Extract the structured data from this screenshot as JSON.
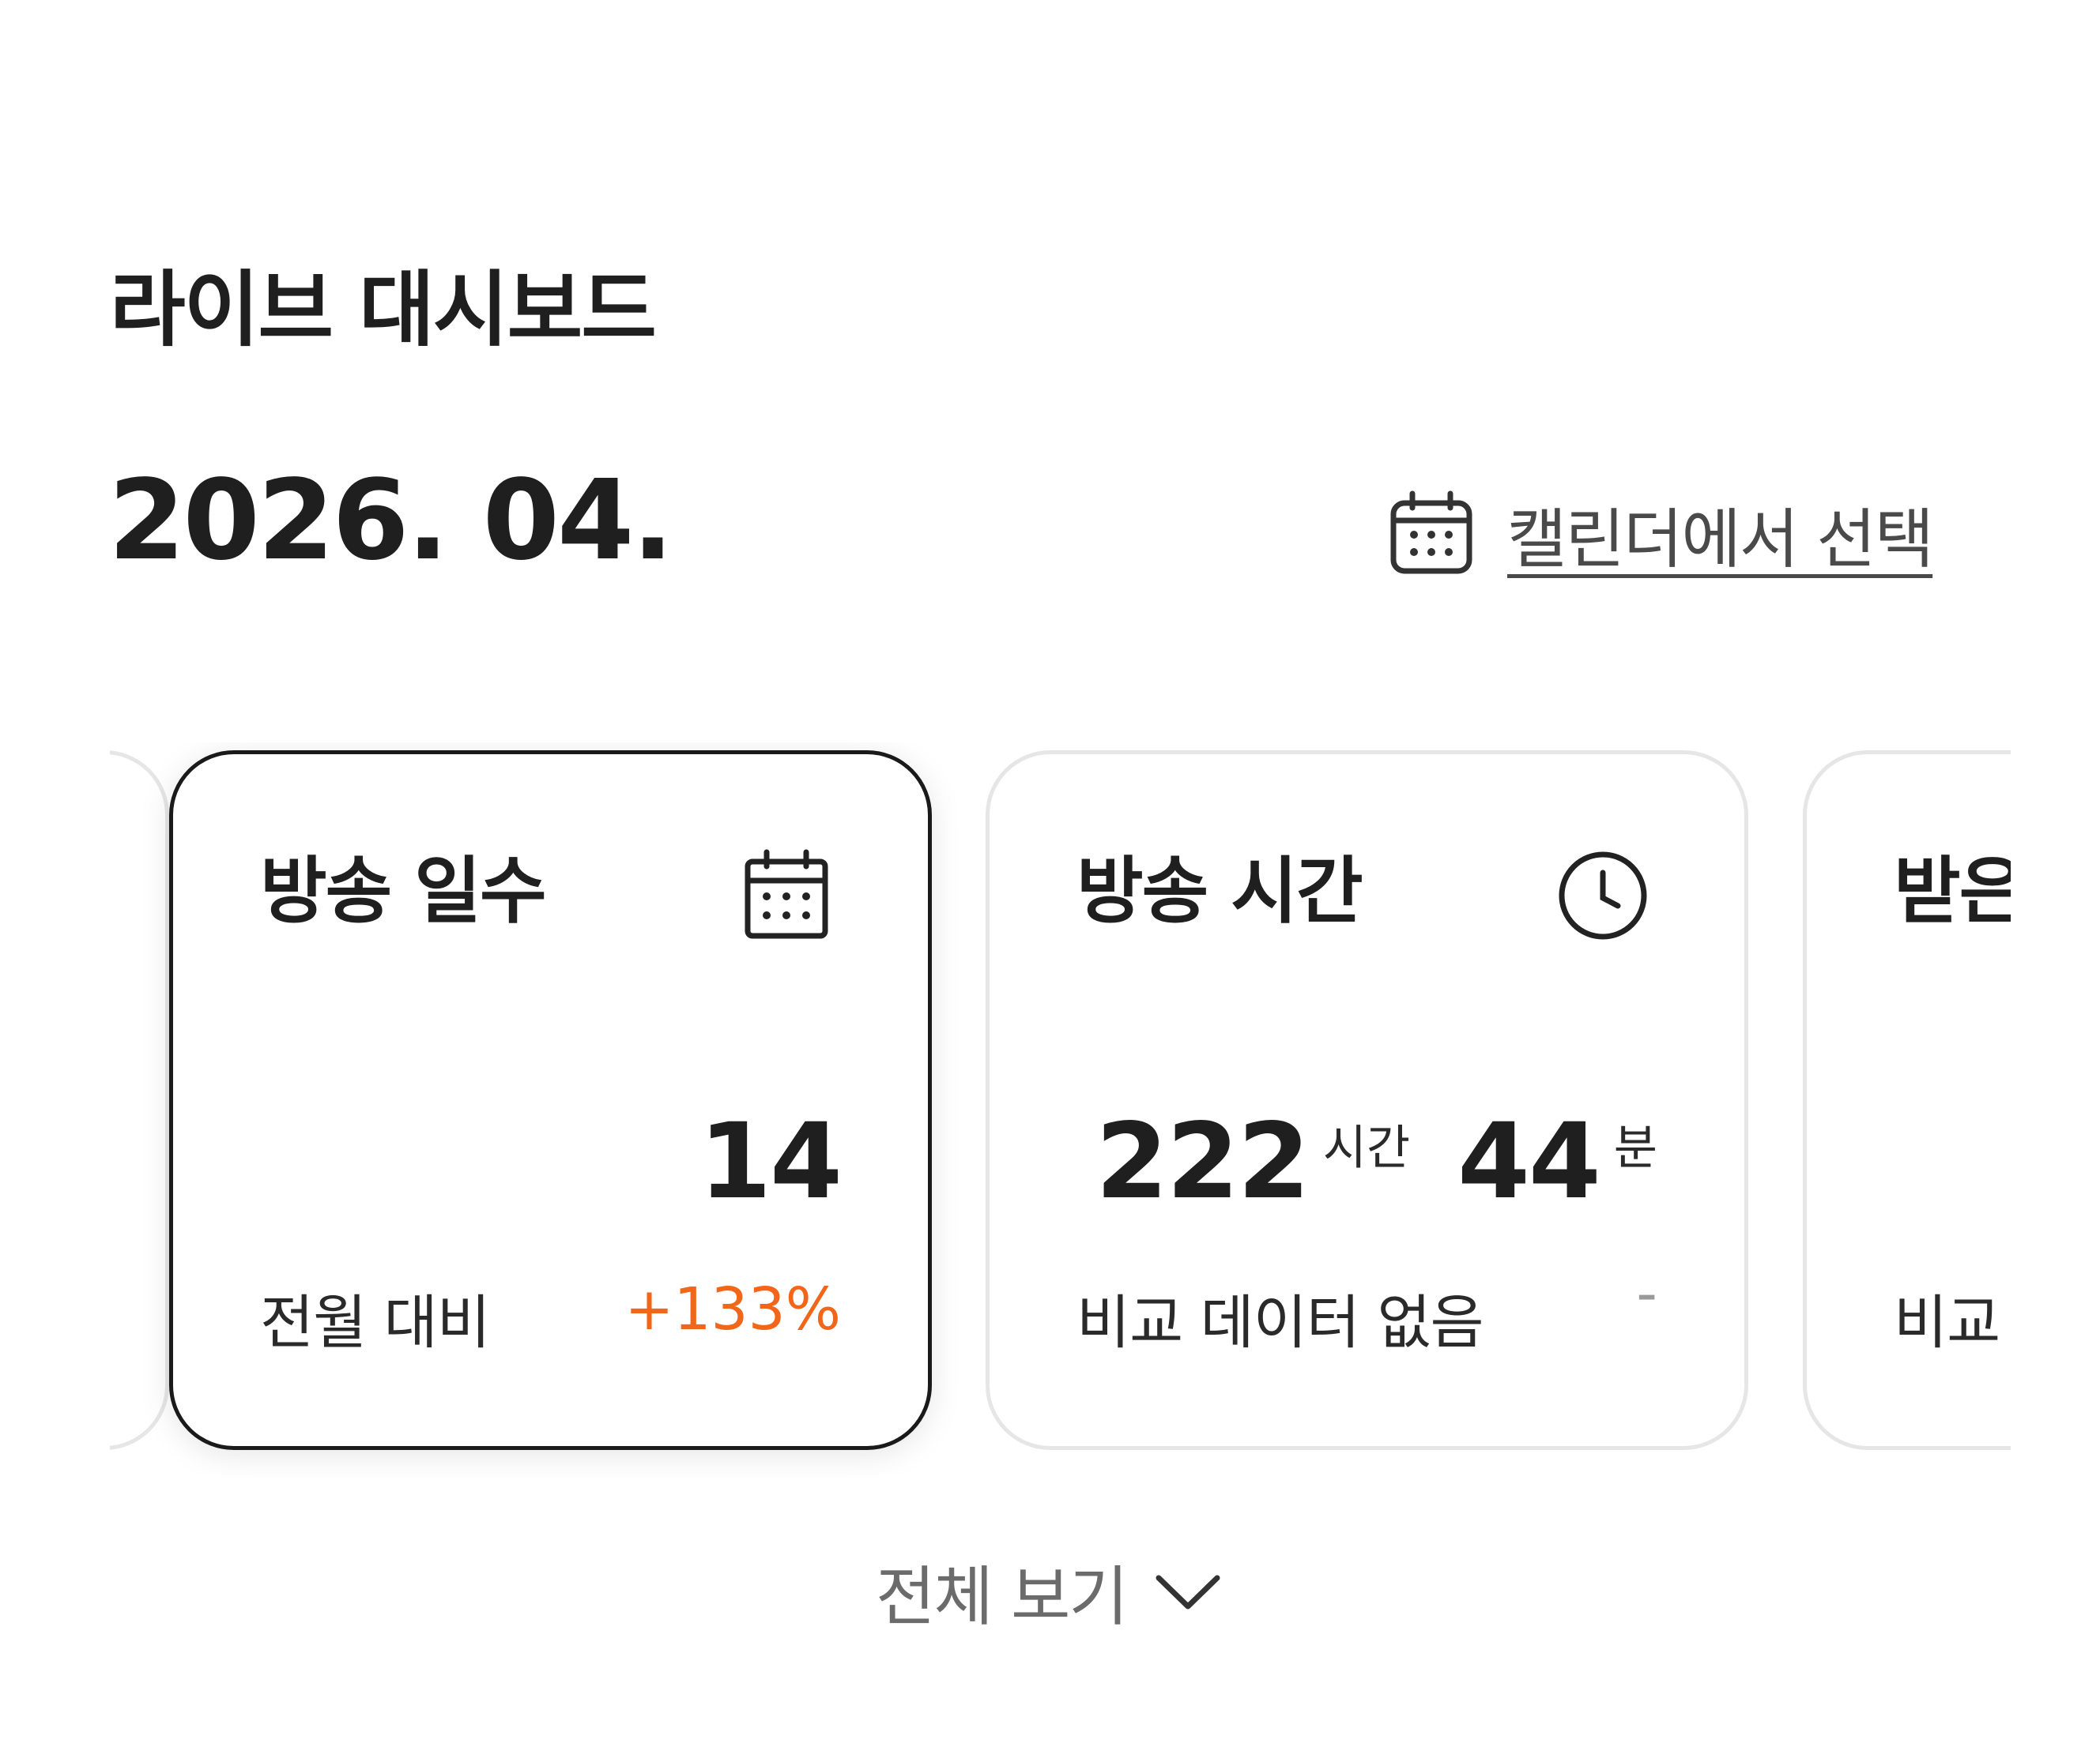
{
  "header": {
    "title": "라이브 대시보드",
    "month": "2026. 04.",
    "calendar_select_label": "캘린더에서 선택"
  },
  "cards": [
    {
      "title": "방송 일수",
      "icon": "calendar-icon",
      "value": "14",
      "compare_label": "전월 대비",
      "compare_value": "+133%",
      "selected": true
    },
    {
      "title": "방송 시간",
      "icon": "clock-icon",
      "hours_value": "222",
      "hours_unit": "시간",
      "minutes_value": "44",
      "minutes_unit": "분",
      "compare_label": "비교 데이터 없음",
      "compare_value": "-",
      "selected": false
    },
    {
      "title": "받은",
      "compare_label": "비교",
      "partial": true
    }
  ],
  "footer": {
    "see_all_label": "전체 보기"
  },
  "colors": {
    "positive": "#f2661a",
    "text": "#1f1f1f",
    "muted": "#9a9a9a",
    "card_border": "#e6e6e6",
    "selected_border": "#1a1a1a"
  }
}
